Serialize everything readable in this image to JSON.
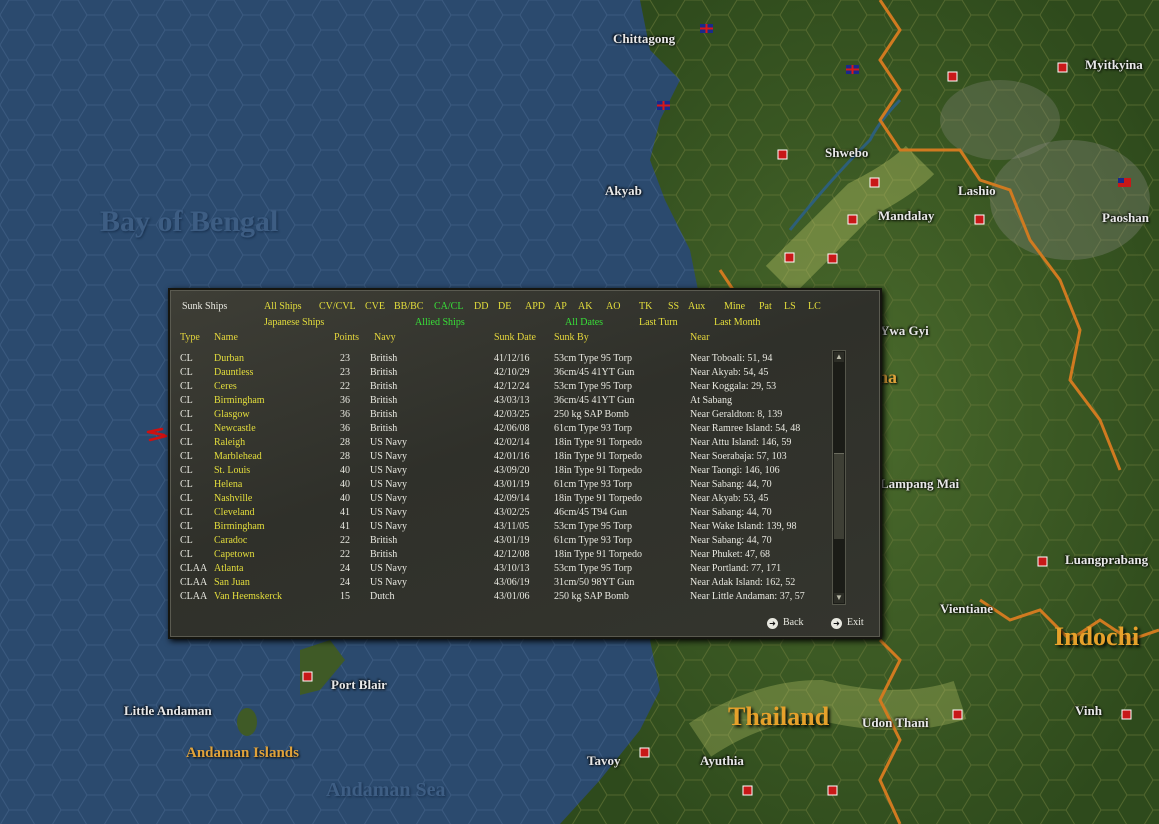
{
  "map": {
    "cities": [
      "Chittagong",
      "Akyab",
      "Shwebo",
      "Lashio",
      "Mandalay",
      "Myitkyina",
      "Paoshan",
      "Ywa Gyi",
      "Lampang Mai",
      "Luangprabang",
      "Vientiane",
      "Port Blair",
      "Little Andaman",
      "Tavoy",
      "Ayuthia",
      "Udon Thani",
      "Vinh"
    ],
    "regions": [
      "Andaman Islands"
    ],
    "countries": [
      "Thailand",
      "Indochi",
      "na"
    ],
    "seas": [
      "Bay of Bengal",
      "Andaman Sea"
    ]
  },
  "panel": {
    "title": "Sunk Ships",
    "filters_row1": [
      "All Ships",
      "CV/CVL",
      "CVE",
      "BB/BC",
      "CA/CL",
      "DD",
      "DE",
      "APD",
      "AP",
      "AK",
      "AO",
      "TK",
      "SS",
      "Aux",
      "Mine",
      "Pat",
      "LS",
      "LC"
    ],
    "active_filter": "CA/CL",
    "side_filters": [
      "Japanese Ships",
      "Allied Ships"
    ],
    "active_side": "Allied Ships",
    "date_filters": [
      "All Dates",
      "Last Turn",
      "Last Month"
    ],
    "active_date": "All Dates",
    "columns": {
      "type": "Type",
      "name": "Name",
      "points": "Points",
      "navy": "Navy",
      "sunk_date": "Sunk Date",
      "sunk_by": "Sunk By",
      "near": "Near"
    },
    "rows": [
      {
        "type": "CL",
        "name": "Durban",
        "points": "23",
        "navy": "British",
        "date": "41/12/16",
        "by": "53cm Type 95 Torp",
        "near": "Near Toboali: 51, 94"
      },
      {
        "type": "CL",
        "name": "Dauntless",
        "points": "23",
        "navy": "British",
        "date": "42/10/29",
        "by": "36cm/45 41YT Gun",
        "near": "Near Akyab: 54, 45"
      },
      {
        "type": "CL",
        "name": "Ceres",
        "points": "22",
        "navy": "British",
        "date": "42/12/24",
        "by": "53cm Type 95 Torp",
        "near": "Near Koggala: 29, 53"
      },
      {
        "type": "CL",
        "name": "Birmingham",
        "points": "36",
        "navy": "British",
        "date": "43/03/13",
        "by": "36cm/45 41YT Gun",
        "near": "At Sabang"
      },
      {
        "type": "CL",
        "name": "Glasgow",
        "points": "36",
        "navy": "British",
        "date": "42/03/25",
        "by": "250 kg SAP Bomb",
        "near": "Near Geraldton: 8, 139"
      },
      {
        "type": "CL",
        "name": "Newcastle",
        "points": "36",
        "navy": "British",
        "date": "42/06/08",
        "by": "61cm Type 93 Torp",
        "near": "Near Ramree Island: 54, 48"
      },
      {
        "type": "CL",
        "name": "Raleigh",
        "points": "28",
        "navy": "US Navy",
        "date": "42/02/14",
        "by": "18in Type 91 Torpedo",
        "near": "Near Attu Island: 146, 59"
      },
      {
        "type": "CL",
        "name": "Marblehead",
        "points": "28",
        "navy": "US Navy",
        "date": "42/01/16",
        "by": "18in Type 91 Torpedo",
        "near": "Near Soerabaja: 57, 103"
      },
      {
        "type": "CL",
        "name": "St. Louis",
        "points": "40",
        "navy": "US Navy",
        "date": "43/09/20",
        "by": "18in Type 91 Torpedo",
        "near": "Near Taongi: 146, 106"
      },
      {
        "type": "CL",
        "name": "Helena",
        "points": "40",
        "navy": "US Navy",
        "date": "43/01/19",
        "by": "61cm Type 93 Torp",
        "near": "Near Sabang: 44, 70"
      },
      {
        "type": "CL",
        "name": "Nashville",
        "points": "40",
        "navy": "US Navy",
        "date": "42/09/14",
        "by": "18in Type 91 Torpedo",
        "near": "Near Akyab: 53, 45"
      },
      {
        "type": "CL",
        "name": "Cleveland",
        "points": "41",
        "navy": "US Navy",
        "date": "43/02/25",
        "by": "46cm/45 T94 Gun",
        "near": "Near Sabang: 44, 70"
      },
      {
        "type": "CL",
        "name": "Birmingham",
        "points": "41",
        "navy": "US Navy",
        "date": "43/11/05",
        "by": "53cm Type 95 Torp",
        "near": "Near Wake Island: 139, 98"
      },
      {
        "type": "CL",
        "name": "Caradoc",
        "points": "22",
        "navy": "British",
        "date": "43/01/19",
        "by": "61cm Type 93 Torp",
        "near": "Near Sabang: 44, 70"
      },
      {
        "type": "CL",
        "name": "Capetown",
        "points": "22",
        "navy": "British",
        "date": "42/12/08",
        "by": "18in Type 91 Torpedo",
        "near": "Near Phuket: 47, 68"
      },
      {
        "type": "CLAA",
        "name": "Atlanta",
        "points": "24",
        "navy": "US Navy",
        "date": "43/10/13",
        "by": "53cm Type 95 Torp",
        "near": "Near Portland: 77, 171"
      },
      {
        "type": "CLAA",
        "name": "San Juan",
        "points": "24",
        "navy": "US Navy",
        "date": "43/06/19",
        "by": "31cm/50 98YT Gun",
        "near": "Near Adak Island: 162, 52"
      },
      {
        "type": "CLAA",
        "name": "Van Heemskerck",
        "points": "15",
        "navy": "Dutch",
        "date": "43/01/06",
        "by": "250 kg SAP Bomb",
        "near": "Near Little Andaman: 37, 57"
      }
    ],
    "back_label": "Back",
    "exit_label": "Exit",
    "scroll_position": 0.62
  },
  "colors": {
    "ocean": "#2b4a6e",
    "land": "#3f5a26",
    "highlight": "#38e038",
    "link": "#e4de3c",
    "annotation": "#d01010"
  }
}
